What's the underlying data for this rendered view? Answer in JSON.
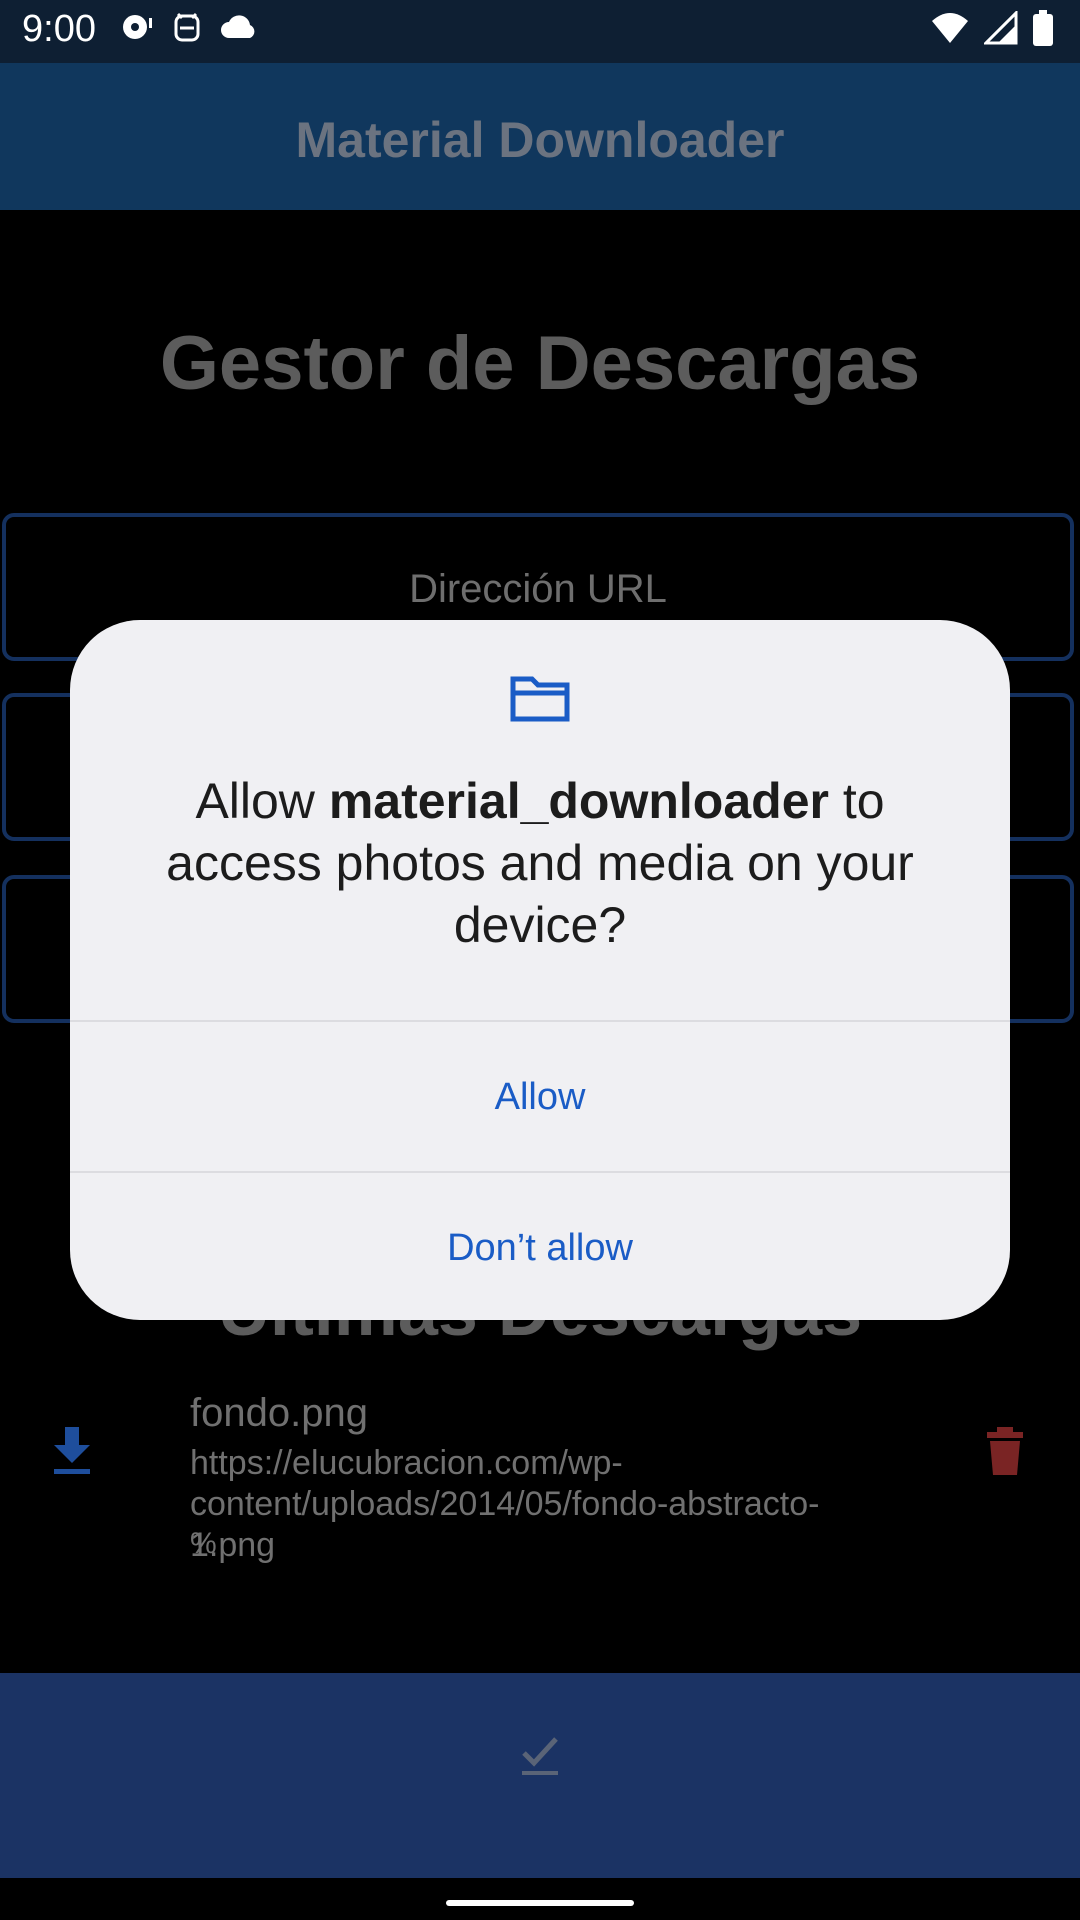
{
  "status_bar": {
    "time": "9:00"
  },
  "app_bar": {
    "title": "Material Downloader"
  },
  "page": {
    "heading": "Gestor de Descargas"
  },
  "form": {
    "url_label": "Dirección URL"
  },
  "recent": {
    "heading": "Últimas Descargas",
    "items": [
      {
        "title": "fondo.png",
        "url": "https://elucubracion.com/wp-content/uploads/2014/05/fondo-abstracto-1.png",
        "progress": "%"
      }
    ]
  },
  "dialog": {
    "prefix": "Allow ",
    "app_name": "material_downloader",
    "suffix": " to access photos and media on your device?",
    "allow_label": "Allow",
    "deny_label": "Don’t allow"
  },
  "colors": {
    "accent": "#1a5cc6",
    "app_bar": "#10375d",
    "bottom_bar": "#1b3364",
    "delete": "#7a2424",
    "dialog_bg": "#f0f0f3"
  },
  "icons": {
    "status": [
      "media-icon",
      "assistant-icon",
      "cloud-icon",
      "wifi-icon",
      "signal-icon",
      "battery-icon"
    ],
    "row": [
      "download-icon",
      "delete-icon"
    ],
    "dialog": "folder-icon",
    "bottom_bar": "check-icon"
  }
}
